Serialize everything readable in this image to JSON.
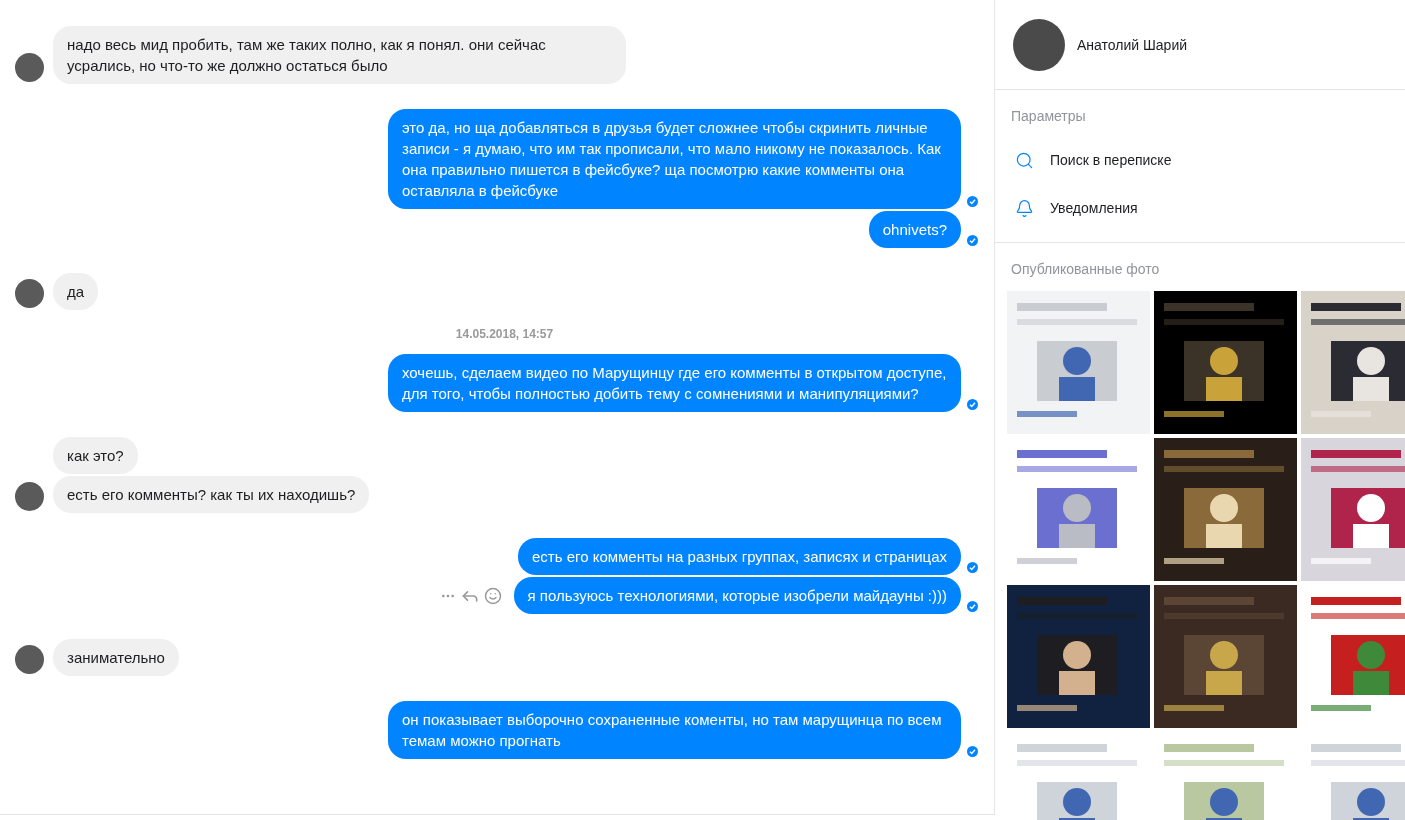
{
  "messages": [
    {
      "kind": "incoming",
      "bubbles": [
        {
          "text": "надо весь мид пробить, там же таких полно, как я понял. они сейчас усрались, но что-то же должно остаться было"
        }
      ]
    },
    {
      "kind": "outgoing",
      "bubbles": [
        {
          "text": "это да, но ща добавляться в друзья будет сложнее чтобы скринить личные записи - я думаю, что им так прописали, что мало никому не показалось. Как она правильно пишется в фейсбуке? ща посмотрю какие комменты она оставляла в фейсбуке",
          "hovered": false
        },
        {
          "text": "ohnivets?",
          "hovered": false
        }
      ]
    },
    {
      "kind": "incoming",
      "bubbles": [
        {
          "text": "да"
        }
      ]
    },
    {
      "kind": "timestamp",
      "text": "14.05.2018, 14:57"
    },
    {
      "kind": "outgoing",
      "bubbles": [
        {
          "text": "хочешь, сделаем видео по Марущинцу где его комменты в открытом доступе, для того, чтобы полностью добить тему с сомнениями и манипуляциями?",
          "hovered": false
        }
      ]
    },
    {
      "kind": "incoming",
      "bubbles": [
        {
          "text": "как это?"
        },
        {
          "text": "есть его комменты? как ты их находишь?"
        }
      ]
    },
    {
      "kind": "outgoing",
      "bubbles": [
        {
          "text": "есть его комменты на разных группах, записях и страницах",
          "hovered": false
        },
        {
          "text": "я пользуюсь технологиями, которые изобрели майдауны :)))",
          "hovered": true
        }
      ]
    },
    {
      "kind": "incoming",
      "bubbles": [
        {
          "text": "занимательно"
        }
      ]
    },
    {
      "kind": "outgoing",
      "bubbles": [
        {
          "text": "он показывает выборочно сохраненные коменты, но там марущинца по всем темам можно прогнать",
          "hovered": false
        }
      ]
    }
  ],
  "sidebar": {
    "contact_name": "Анатолий Шарий",
    "options_title": "Параметры",
    "options": [
      {
        "kind": "search",
        "label": "Поиск в переписке"
      },
      {
        "kind": "notifications",
        "label": "Уведомления"
      }
    ],
    "photos_title": "Опубликованные фото"
  }
}
